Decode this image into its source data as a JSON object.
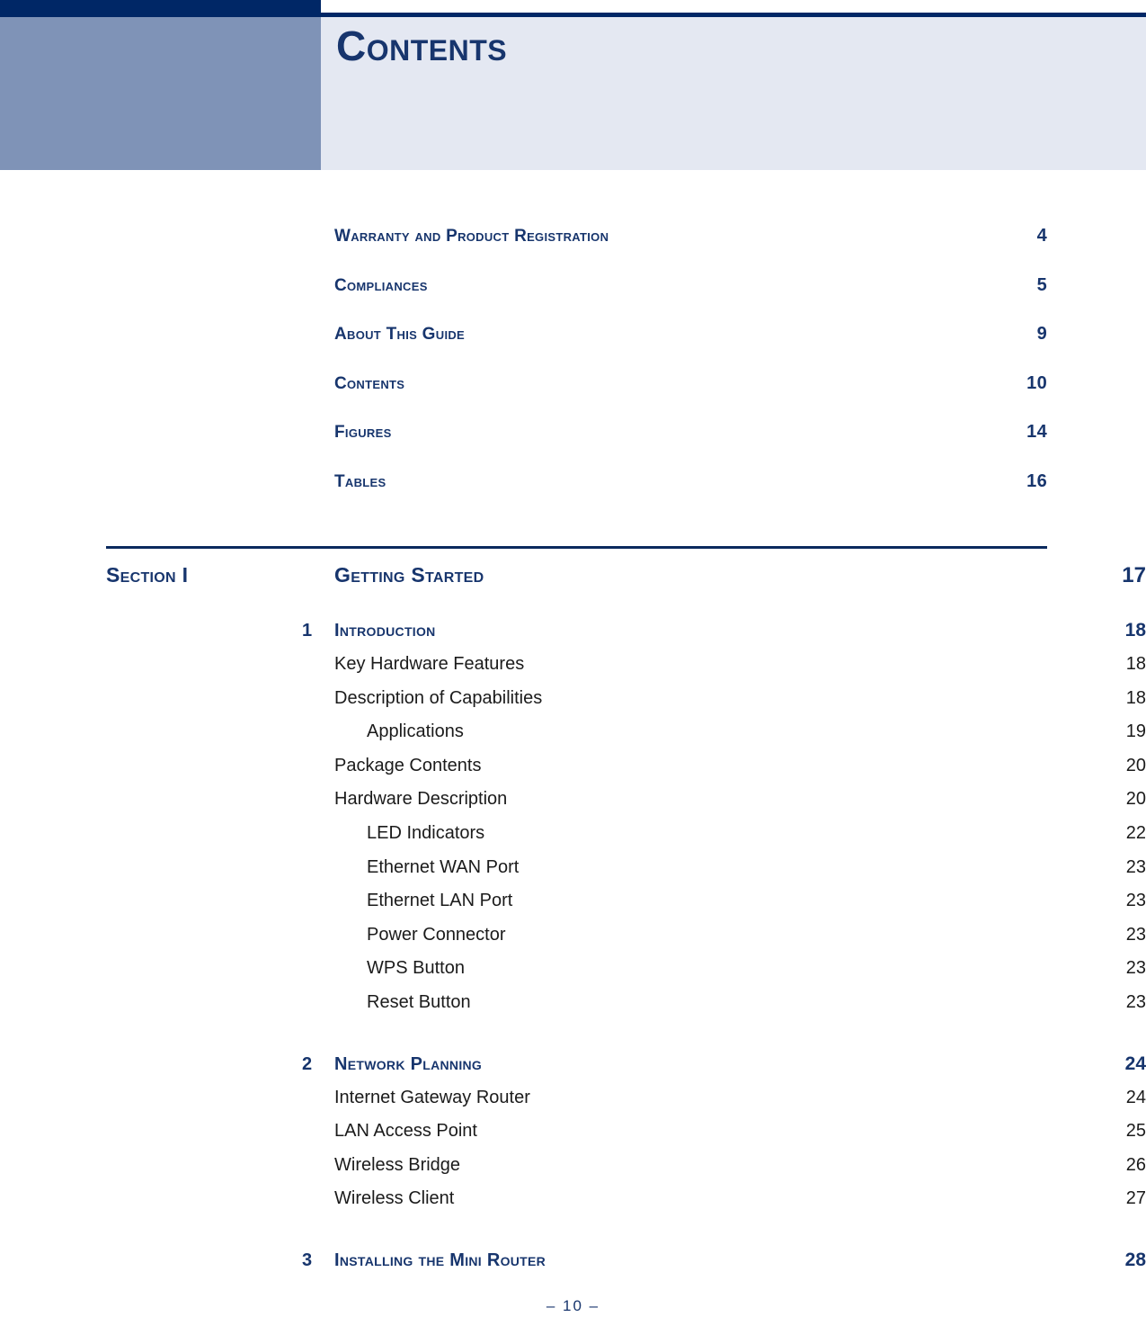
{
  "header": {
    "title": "Contents"
  },
  "front_matter": [
    {
      "label": "Warranty and Product Registration",
      "page": "4"
    },
    {
      "label": "Compliances",
      "page": "5"
    },
    {
      "label": "About This Guide",
      "page": "9"
    },
    {
      "label": "Contents",
      "page": "10"
    },
    {
      "label": "Figures",
      "page": "14"
    },
    {
      "label": "Tables",
      "page": "16"
    }
  ],
  "section": {
    "label": "Section I",
    "title": "Getting Started",
    "page": "17"
  },
  "chapters": [
    {
      "number": "1",
      "label": "Introduction",
      "page": "18",
      "entries": [
        {
          "label": "Key Hardware Features",
          "page": "18",
          "level": 2
        },
        {
          "label": "Description of Capabilities",
          "page": "18",
          "level": 2
        },
        {
          "label": "Applications",
          "page": "19",
          "level": 3
        },
        {
          "label": "Package Contents",
          "page": "20",
          "level": 2
        },
        {
          "label": "Hardware Description",
          "page": "20",
          "level": 2
        },
        {
          "label": "LED Indicators",
          "page": "22",
          "level": 3
        },
        {
          "label": "Ethernet WAN Port",
          "page": "23",
          "level": 3
        },
        {
          "label": "Ethernet LAN Port",
          "page": "23",
          "level": 3
        },
        {
          "label": "Power Connector",
          "page": "23",
          "level": 3
        },
        {
          "label": "WPS Button",
          "page": "23",
          "level": 3
        },
        {
          "label": "Reset Button",
          "page": "23",
          "level": 3
        }
      ]
    },
    {
      "number": "2",
      "label": "Network Planning",
      "page": "24",
      "entries": [
        {
          "label": "Internet Gateway Router",
          "page": "24",
          "level": 2
        },
        {
          "label": "LAN Access Point",
          "page": "25",
          "level": 2
        },
        {
          "label": "Wireless Bridge",
          "page": "26",
          "level": 2
        },
        {
          "label": "Wireless Client",
          "page": "27",
          "level": 2
        }
      ]
    },
    {
      "number": "3",
      "label": "Installing the Mini Router",
      "page": "28",
      "entries": []
    }
  ],
  "footer": {
    "page_marker": "–  10  –"
  },
  "colors": {
    "navy": "#002766",
    "heading_navy": "#17356d",
    "accent_blue": "#7f93b7",
    "light_panel": "#e4e8f2",
    "body_text": "#1b1b1b"
  }
}
